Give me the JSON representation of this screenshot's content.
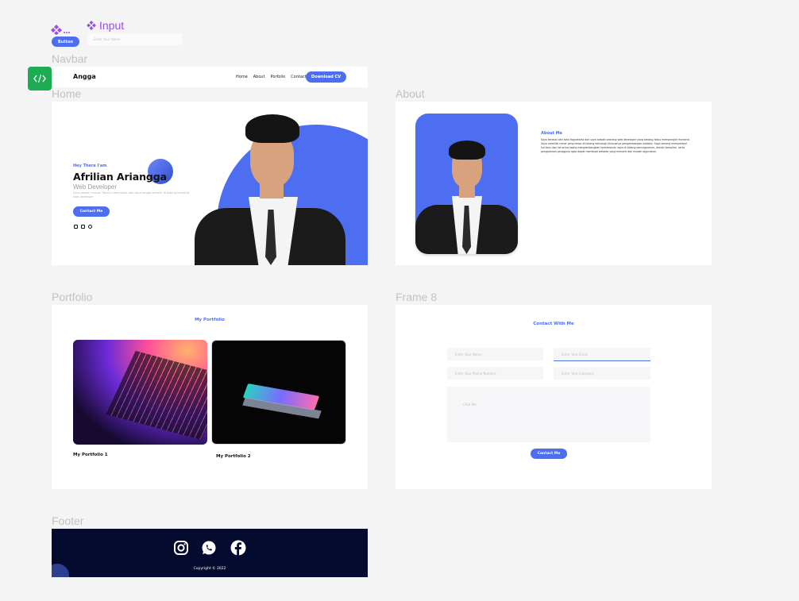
{
  "components": {
    "input_title": "Input",
    "button_label": "Button",
    "input_placeholder": "Enter Your Name"
  },
  "frames": {
    "navbar": "Navbar",
    "home": "Home",
    "about": "About",
    "portfolio": "Portfolio",
    "contact": "Frame 8",
    "footer": "Footer"
  },
  "navbar": {
    "logo": "Angga",
    "links": [
      "Home",
      "About",
      "Porfolio",
      "Contact"
    ],
    "cta": "Download CV"
  },
  "home": {
    "greeting": "Hey There I'am",
    "name": "Afrilian Ariangga",
    "role": "Web Developer",
    "description": "Saya adalah lulusan Teknik Informatika dan saya sangat tertarik di bidang frontend web developer",
    "button": "Contact Me"
  },
  "about": {
    "title": "About Me",
    "text": "Saya berasal dari kota Yogyakarta dan saya adalah seorang web developer yang sedang fokus mempelajari frontend. Saya memiliki minat yang besar di bidang teknologi khususnya pengembangan website. Saya senang mempelajari hal baru dan terus berusaha mengembangkan kemampuan saya di bidang pemrograman, desain tampilan, serta pengalaman pengguna agar dapat membuat website yang menarik dan mudah digunakan."
  },
  "portfolio": {
    "title": "My Portfolio",
    "items": [
      "My Portfolio 1",
      "My Portfolio 2"
    ]
  },
  "contact": {
    "title": "Contact With Me",
    "name_placeholder": "Enter Your Name",
    "email_placeholder": "Enter Your Email",
    "phone_placeholder": "Enter Your Phone Number",
    "company_placeholder": "Enter Your Company",
    "message_placeholder": "Chat Me",
    "button": "Contact Me"
  },
  "footer": {
    "copyright": "Copyright © 2022"
  },
  "colors": {
    "accent": "#4e6ef2",
    "footer_bg": "#050b2e",
    "badge": "#1dac54",
    "component_purple": "#9b51e0"
  },
  "icons": [
    "component-icon",
    "code-icon",
    "instagram-icon",
    "whatsapp-icon",
    "facebook-icon",
    "github-icon",
    "mail-icon"
  ]
}
